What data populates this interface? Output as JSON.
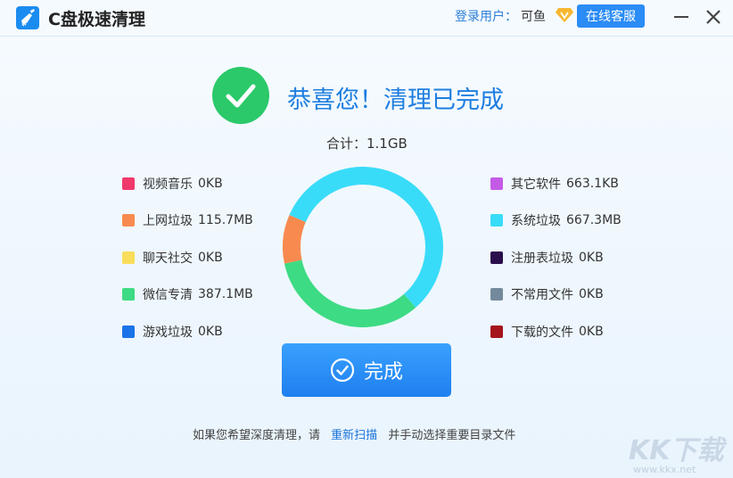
{
  "window": {
    "title": "C盘极速清理",
    "user_label": "登录用户：",
    "user_name": "可鱼",
    "service_button": "在线客服",
    "vip_badge_icon": "vip-diamond-icon"
  },
  "result": {
    "headline": "恭喜您！清理已完成",
    "total": "合计：1.1GB"
  },
  "legend_left": [
    {
      "name": "视频音乐",
      "size": "0KB",
      "color": "#f0386b"
    },
    {
      "name": "上网垃圾",
      "size": "115.7MB",
      "color": "#f88a4f"
    },
    {
      "name": "聊天社交",
      "size": "0KB",
      "color": "#f9dd5b"
    },
    {
      "name": "微信专清",
      "size": "387.1MB",
      "color": "#3ddb84"
    },
    {
      "name": "游戏垃圾",
      "size": "0KB",
      "color": "#1a73e8"
    }
  ],
  "legend_right": [
    {
      "name": "其它软件",
      "size": "663.1KB",
      "color": "#c45be6"
    },
    {
      "name": "系统垃圾",
      "size": "667.3MB",
      "color": "#39dcf8"
    },
    {
      "name": "注册表垃圾",
      "size": "0KB",
      "color": "#2b0f4d"
    },
    {
      "name": "不常用文件",
      "size": "0KB",
      "color": "#748a9c"
    },
    {
      "name": "下载的文件",
      "size": "0KB",
      "color": "#a5141c"
    }
  ],
  "donut": {
    "segments": [
      {
        "name": "系统垃圾",
        "value": 667.3,
        "color": "#39dcf8"
      },
      {
        "name": "微信专清",
        "value": 387.1,
        "color": "#3ddb84"
      },
      {
        "name": "上网垃圾",
        "value": 115.7,
        "color": "#f88a4f"
      }
    ]
  },
  "done_button": {
    "label": "完成"
  },
  "footer": {
    "prefix": "如果您希望深度清理，请",
    "link": "重新扫描",
    "suffix": "并手动选择重要目录文件"
  },
  "watermark": {
    "text": "KK下载",
    "url": "www.kkx.net"
  }
}
